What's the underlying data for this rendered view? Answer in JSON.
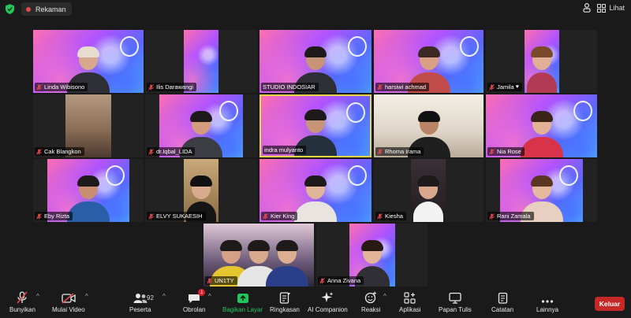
{
  "header": {
    "recording_label": "Rekaman",
    "view_label": "Lihat"
  },
  "participants": [
    {
      "name": "Linda Wibisono",
      "muted": true
    },
    {
      "name": "Ilis Darawangi",
      "muted": true
    },
    {
      "name": "STUDIO INDOSIAR",
      "muted": false
    },
    {
      "name": "harsiwi achmad",
      "muted": true
    },
    {
      "name": "Jamila",
      "muted": true,
      "heart": "♥"
    },
    {
      "name": "Cak Blangkon",
      "muted": true
    },
    {
      "name": "dr.Iqbal_LIDA",
      "muted": true
    },
    {
      "name": "indra mulyanto",
      "muted": false,
      "speaking": true
    },
    {
      "name": "Rhoma Irama",
      "muted": true
    },
    {
      "name": "Nia Rose",
      "muted": true
    },
    {
      "name": "Eby Rizta",
      "muted": true
    },
    {
      "name": "ELVY SUKAESIH",
      "muted": true
    },
    {
      "name": "Kier King",
      "muted": true
    },
    {
      "name": "Kiesha",
      "muted": true
    },
    {
      "name": "Rani Zamala",
      "muted": true
    },
    {
      "name": "UN1TY",
      "muted": true
    },
    {
      "name": "Anna Zivana",
      "muted": true
    }
  ],
  "toolbar": {
    "unmute": "Bunyikan",
    "start_video": "Mulai Video",
    "participants": "Peserta",
    "participants_count": "92",
    "chat": "Obrolan",
    "chat_badge": "1",
    "share": "Bagikan Layar",
    "summary": "Ringkasan",
    "companion": "AI Companion",
    "reactions": "Reaksi",
    "apps": "Aplikasi",
    "whiteboard": "Papan Tulis",
    "notes": "Catatan",
    "more": "Lainnya",
    "leave": "Keluar"
  },
  "colors": {
    "background": "#1a1a1a",
    "leave_button": "#c62828",
    "active_speaker_border": "#e8d64a",
    "share_green": "#22c55e",
    "muted_red": "#e5484d"
  }
}
